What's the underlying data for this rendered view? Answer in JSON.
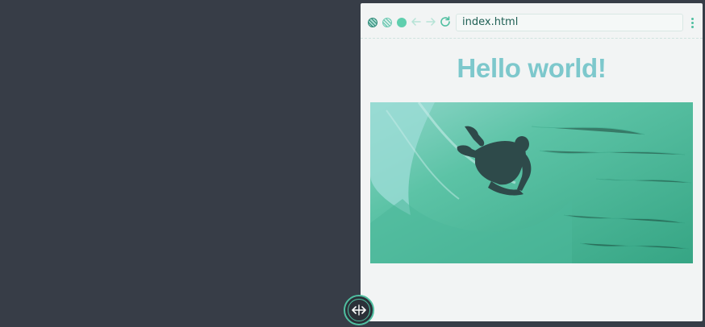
{
  "browser": {
    "url": "index.html",
    "icons": {
      "close": "close-dot-icon",
      "minimize": "minimize-dot-icon",
      "maximize": "maximize-dot-icon",
      "back": "arrow-left-icon",
      "forward": "arrow-right-icon",
      "reload": "reload-icon",
      "menu": "kebab-menu-icon"
    }
  },
  "page": {
    "heading": "Hello world!",
    "image": "surfer-in-wave-photo"
  },
  "resize_handle": {
    "icon": "resize-horizontal-icon"
  },
  "colors": {
    "background": "#373d47",
    "accent": "#4fbfa0",
    "heading": "#7dc8cc",
    "water": "#3fae8c"
  }
}
